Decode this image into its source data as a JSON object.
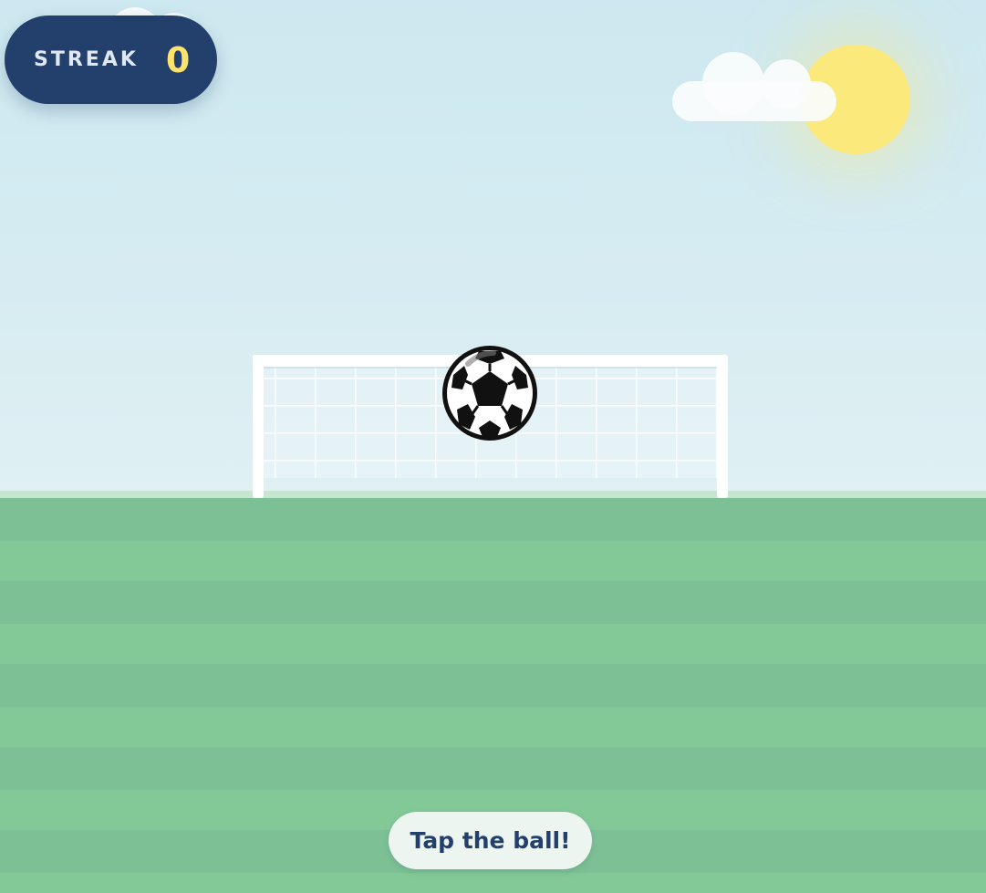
{
  "hud": {
    "streak_label": "STREAK",
    "streak_value": "0"
  },
  "instruction": {
    "text": "Tap the ball!"
  },
  "icons": {
    "ball": "soccer-ball-icon",
    "sun": "sun-icon",
    "cloud": "cloud-icon"
  },
  "colors": {
    "hud_background": "#233f6b",
    "streak_value": "#fbe36e",
    "streak_label": "#dfe7f3",
    "sky_top": "#cde8f0",
    "sky_bottom": "#e0f0f3",
    "grass_dark": "#7dc096",
    "grass_light": "#83c897",
    "sun": "#fbe97c",
    "pill_background": "#edf5f1",
    "pill_text": "#233f6b"
  }
}
